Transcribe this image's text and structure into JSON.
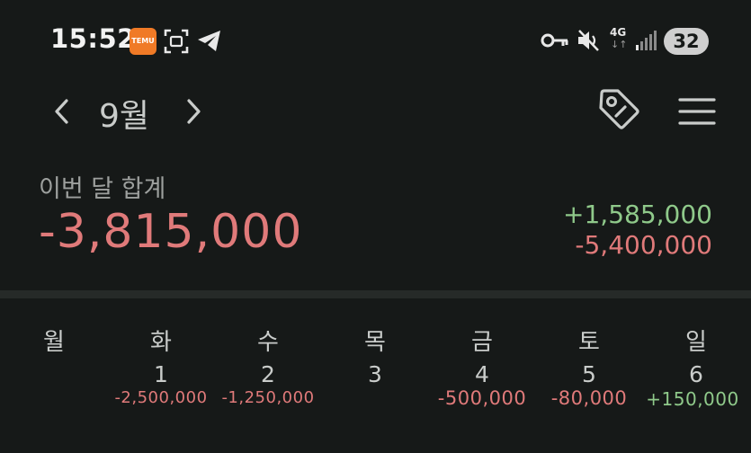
{
  "status_bar": {
    "time": "15:52",
    "temu_icon_text": "TEMU",
    "network_label": "4G",
    "network_arrows": "↓↑",
    "battery_level": "32",
    "icons": [
      "temu-app-icon",
      "screenshot-icon",
      "telegram-icon",
      "key-icon",
      "mute-icon",
      "signal-icon"
    ]
  },
  "header": {
    "month": "9월",
    "prev_icon": "chevron-left-icon",
    "next_icon": "chevron-right-icon",
    "tag_icon": "tag-icon",
    "menu_icon": "hamburger-menu-icon"
  },
  "summary": {
    "label": "이번 달 합계",
    "total": "-3,815,000",
    "income": "+1,585,000",
    "expense": "-5,400,000"
  },
  "calendar": {
    "weekdays": [
      "월",
      "화",
      "수",
      "목",
      "금",
      "토",
      "일"
    ],
    "days": [
      {
        "num": "1",
        "amount": "-2,500,000",
        "type": "negative"
      },
      {
        "num": "2",
        "amount": "-1,250,000",
        "type": "negative"
      },
      {
        "num": "3",
        "amount": "",
        "type": "none"
      },
      {
        "num": "4",
        "amount": "-500,000",
        "type": "negative"
      },
      {
        "num": "5",
        "amount": "-80,000",
        "type": "negative"
      },
      {
        "num": "6",
        "amount": "+150,000",
        "type": "positive"
      }
    ]
  },
  "colors": {
    "background": "#161918",
    "negative": "#e07a7a",
    "positive": "#8fc98a",
    "divider": "#262a28"
  }
}
